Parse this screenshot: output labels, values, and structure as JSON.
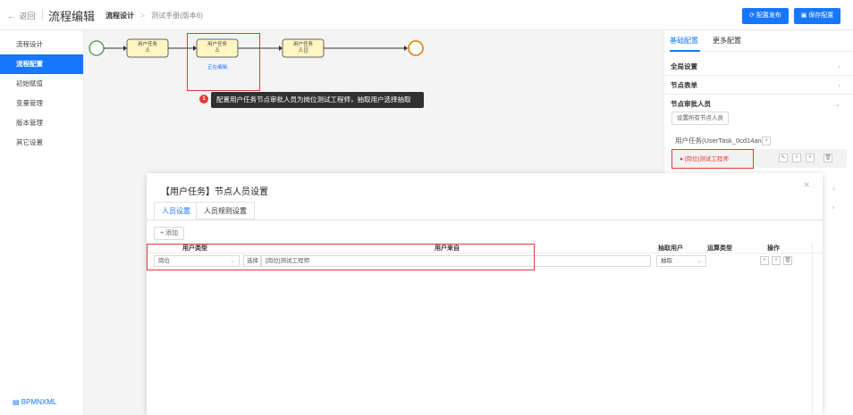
{
  "header": {
    "back_label": "返回",
    "app_title": "流程编辑",
    "breadcrumb_current": "流程设计",
    "breadcrumb_sep": ">",
    "breadcrumb_sub": "测试手册(版本6)",
    "btn_publish": "配置发布",
    "btn_save": "保存配置"
  },
  "sidebar": {
    "items": [
      {
        "label": "流程设计",
        "active": false
      },
      {
        "label": "流程配置",
        "active": true
      },
      {
        "label": "初始赋值",
        "active": false
      },
      {
        "label": "变量管理",
        "active": false
      },
      {
        "label": "版本管理",
        "active": false
      },
      {
        "label": "其它设置",
        "active": false
      }
    ],
    "footer": "BPMNXML"
  },
  "diagram": {
    "task_label": "用户任务",
    "editing_label": "正在编辑"
  },
  "tooltip": {
    "badge": "1",
    "text": "配置用户任务节点审批人员为岗位测试工程师，抽取用户选择抽取"
  },
  "right_panel": {
    "tabs": [
      "基础配置",
      "更多配置"
    ],
    "sections": [
      "全局设置",
      "节点表单",
      "节点审批人员"
    ],
    "set_all_button": "设置所有节点人员",
    "task_node_label": "用户任务(UserTask_0cd14an)",
    "plus": "+",
    "approver_tag": "[岗位]测试工程师"
  },
  "modal": {
    "title": "【用户任务】节点人员设置",
    "tabs": [
      "人员设置",
      "人员规则设置"
    ],
    "add_button": "+ 添加",
    "columns": [
      "用户类型",
      "用户来自",
      "抽取用户",
      "运算类型",
      "操作"
    ],
    "row": {
      "user_type": "岗位",
      "select_label": "选择",
      "source": "[岗位]测试工程师",
      "extract": "抽取"
    }
  }
}
